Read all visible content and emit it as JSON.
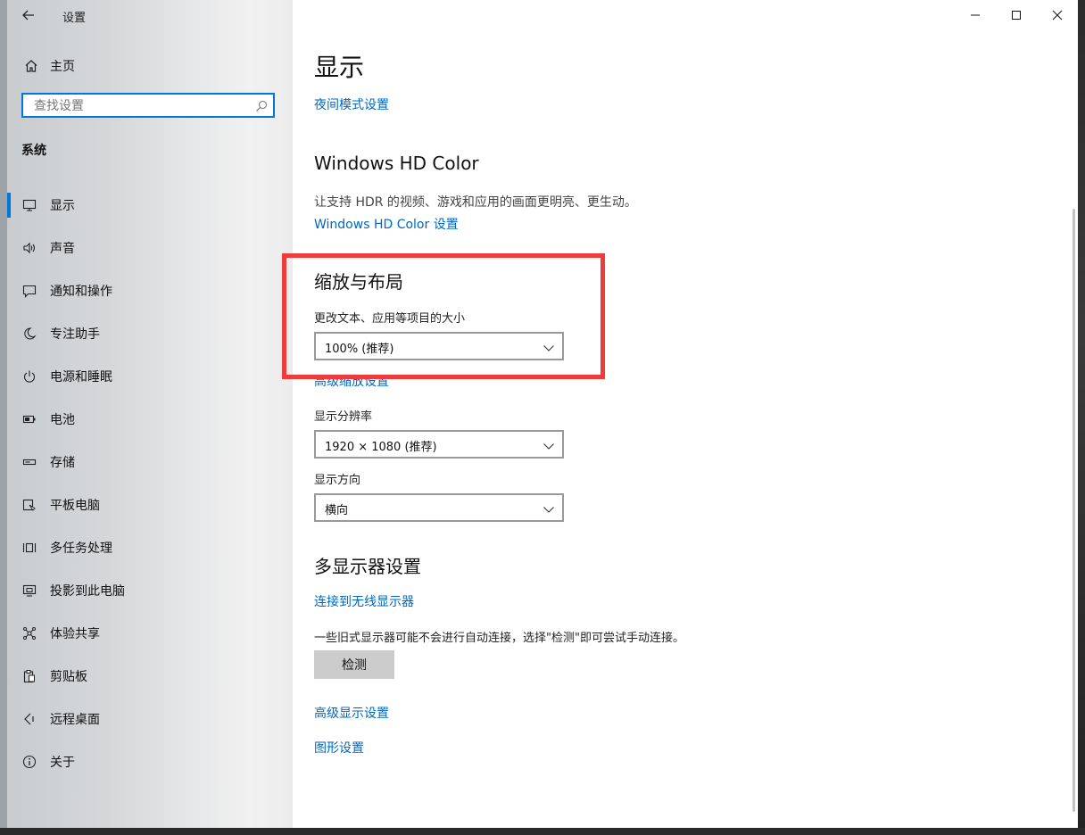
{
  "app": {
    "title": "设置"
  },
  "sidebar": {
    "home_label": "主页",
    "search_placeholder": "查找设置",
    "group_title": "系统",
    "items": [
      {
        "label": "显示",
        "icon": "monitor-icon",
        "selected": true
      },
      {
        "label": "声音",
        "icon": "speaker-icon"
      },
      {
        "label": "通知和操作",
        "icon": "notification-icon"
      },
      {
        "label": "专注助手",
        "icon": "moon-icon"
      },
      {
        "label": "电源和睡眠",
        "icon": "power-icon"
      },
      {
        "label": "电池",
        "icon": "battery-icon"
      },
      {
        "label": "存储",
        "icon": "storage-icon"
      },
      {
        "label": "平板电脑",
        "icon": "tablet-icon"
      },
      {
        "label": "多任务处理",
        "icon": "multitasking-icon"
      },
      {
        "label": "投影到此电脑",
        "icon": "project-icon"
      },
      {
        "label": "体验共享",
        "icon": "share-icon"
      },
      {
        "label": "剪贴板",
        "icon": "clipboard-icon"
      },
      {
        "label": "远程桌面",
        "icon": "remote-desktop-icon"
      },
      {
        "label": "关于",
        "icon": "info-icon"
      }
    ]
  },
  "main": {
    "page_title": "显示",
    "night_mode_link": "夜间模式设置",
    "hdr": {
      "title": "Windows HD Color",
      "desc": "让支持 HDR 的视频、游戏和应用的画面更明亮、更生动。",
      "link": "Windows HD Color 设置"
    },
    "scale": {
      "title": "缩放与布局",
      "size_label": "更改文本、应用等项目的大小",
      "size_value": "100% (推荐)",
      "advanced_link": "高级缩放设置",
      "resolution_label": "显示分辨率",
      "resolution_value": "1920 × 1080 (推荐)",
      "orientation_label": "显示方向",
      "orientation_value": "横向"
    },
    "multi": {
      "title": "多显示器设置",
      "wireless_link": "连接到无线显示器",
      "desc": "一些旧式显示器可能不会进行自动连接，选择\"检测\"即可尝试手动连接。",
      "detect_button": "检测",
      "advanced_display_link": "高级显示设置",
      "graphics_link": "图形设置"
    }
  },
  "colors": {
    "accent": "#0078d7",
    "link": "#0067c0",
    "highlight": "#ee3c3c"
  }
}
